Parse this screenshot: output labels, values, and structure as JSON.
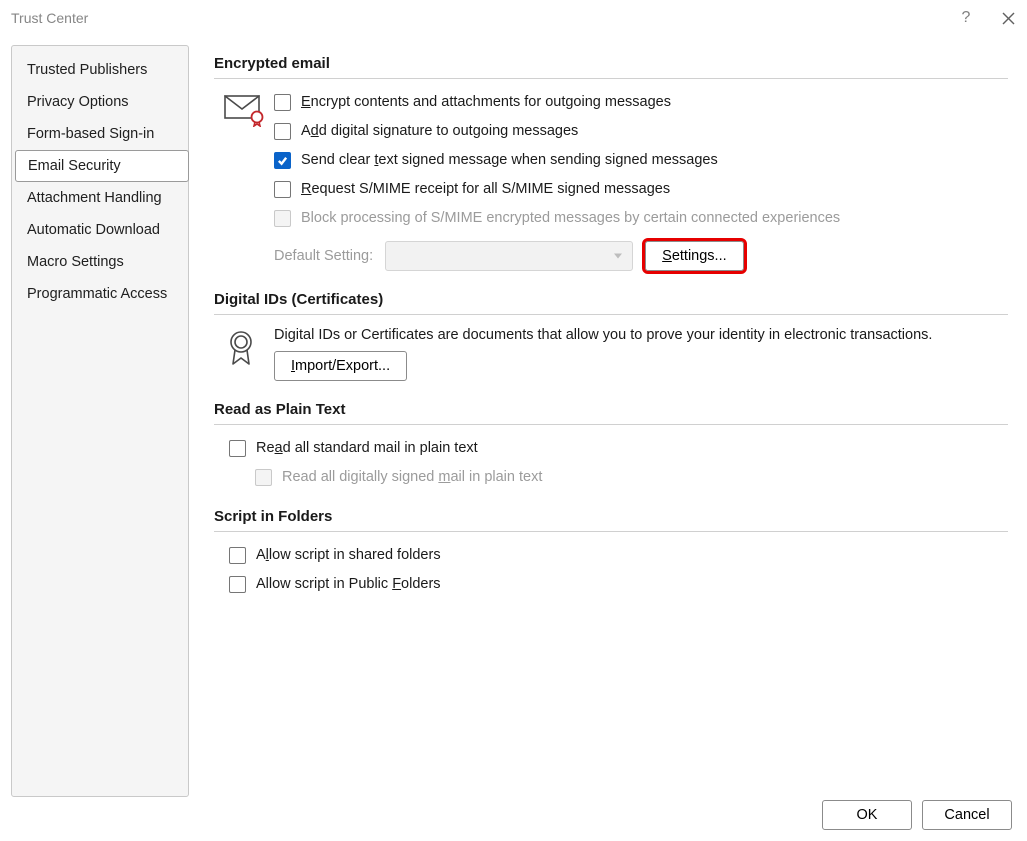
{
  "dialog": {
    "title": "Trust Center"
  },
  "sidebar": {
    "items": [
      "Trusted Publishers",
      "Privacy Options",
      "Form-based Sign-in",
      "Email Security",
      "Attachment Handling",
      "Automatic Download",
      "Macro Settings",
      "Programmatic Access"
    ],
    "selectedIndex": 3
  },
  "sections": {
    "encrypted": {
      "title": "Encrypted email",
      "encrypt_contents": {
        "label_pre": "",
        "u": "E",
        "label_post": "ncrypt contents and attachments for outgoing messages",
        "checked": false
      },
      "add_signature": {
        "label_pre": "A",
        "u": "d",
        "label_post": "d digital signature to outgoing messages",
        "checked": false
      },
      "clear_text": {
        "label_pre": "Send clear ",
        "u": "t",
        "label_post": "ext signed message when sending signed messages",
        "checked": true
      },
      "request_receipt": {
        "label_pre": "",
        "u": "R",
        "label_post": "equest S/MIME receipt for all S/MIME signed messages",
        "checked": false
      },
      "block_processing": {
        "label": "Block processing of S/MIME encrypted messages by certain connected experiences",
        "disabled": true
      },
      "default_setting_label": "Default Setting:",
      "default_setting_value": "",
      "settings_button": {
        "u": "S",
        "rest": "ettings..."
      }
    },
    "digital_ids": {
      "title": "Digital IDs (Certificates)",
      "description": "Digital IDs or Certificates are documents that allow you to prove your identity in electronic transactions.",
      "import_button": {
        "u": "I",
        "rest": "mport/Export..."
      }
    },
    "plain_text": {
      "title": "Read as Plain Text",
      "read_standard": {
        "label_pre": "Re",
        "u": "a",
        "label_post": "d all standard mail in plain text",
        "checked": false
      },
      "read_signed": {
        "label_pre": "Read all digitally signed ",
        "u": "m",
        "label_post": "ail in plain text",
        "disabled": true
      }
    },
    "script": {
      "title": "Script in Folders",
      "shared": {
        "label_pre": "A",
        "u": "l",
        "label_post": "low script in shared folders",
        "checked": false
      },
      "public": {
        "label_pre": "Allow script in Public ",
        "u": "F",
        "label_post": "olders",
        "checked": false
      }
    }
  },
  "footer": {
    "ok": "OK",
    "cancel": "Cancel"
  }
}
